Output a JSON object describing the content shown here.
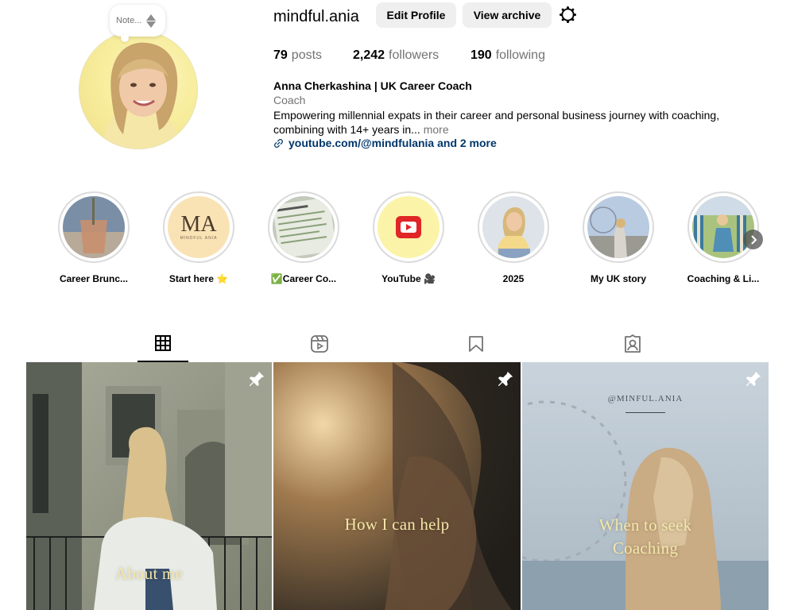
{
  "profile": {
    "note": "Note...",
    "username": "mindful.ania",
    "edit_profile": "Edit Profile",
    "view_archive": "View archive",
    "stats": {
      "posts_count": "79",
      "posts_label": "posts",
      "followers_count": "2,242",
      "followers_label": "followers",
      "following_count": "190",
      "following_label": "following"
    },
    "full_name": "Anna Cherkashina | UK Career Coach",
    "category": "Coach",
    "bio_line1": "Empowering millennial expats in their career and personal business journey with coaching,",
    "bio_line2": "combining with 14+ years in...",
    "bio_more": "more",
    "link": "youtube.com/@mindfulania and 2 more"
  },
  "highlights": [
    {
      "label": "Career Brunc...",
      "icon": "coffee-photo"
    },
    {
      "label": "Start here ⭐",
      "icon": "ma-logo"
    },
    {
      "label": "✅Career Co...",
      "icon": "document-photo"
    },
    {
      "label": "YouTube 🎥",
      "icon": "youtube-logo"
    },
    {
      "label": "2025",
      "icon": "portrait-photo"
    },
    {
      "label": "My UK story",
      "icon": "london-eye-photo"
    },
    {
      "label": "Coaching & Li...",
      "icon": "deckchair-photo"
    }
  ],
  "ma_logo": {
    "letters": "MA",
    "sub": "MINDFUL ANIA"
  },
  "tabs": [
    {
      "name": "posts",
      "icon": "grid-icon",
      "active": true
    },
    {
      "name": "reels",
      "icon": "reels-icon",
      "active": false
    },
    {
      "name": "saved",
      "icon": "bookmark-icon",
      "active": false
    },
    {
      "name": "tagged",
      "icon": "tagged-icon",
      "active": false
    }
  ],
  "posts": [
    {
      "caption": "About me",
      "pinned": true
    },
    {
      "caption": "How I can help",
      "pinned": true
    },
    {
      "caption_line1": "When to seek",
      "caption_line2": "Coaching",
      "watermark": "@MINFUL.ANIA",
      "pinned": true
    }
  ],
  "colors": {
    "link": "#00376b",
    "secondary_text": "#737373",
    "button_bg": "#efefef",
    "caption": "#f4e6a8"
  }
}
